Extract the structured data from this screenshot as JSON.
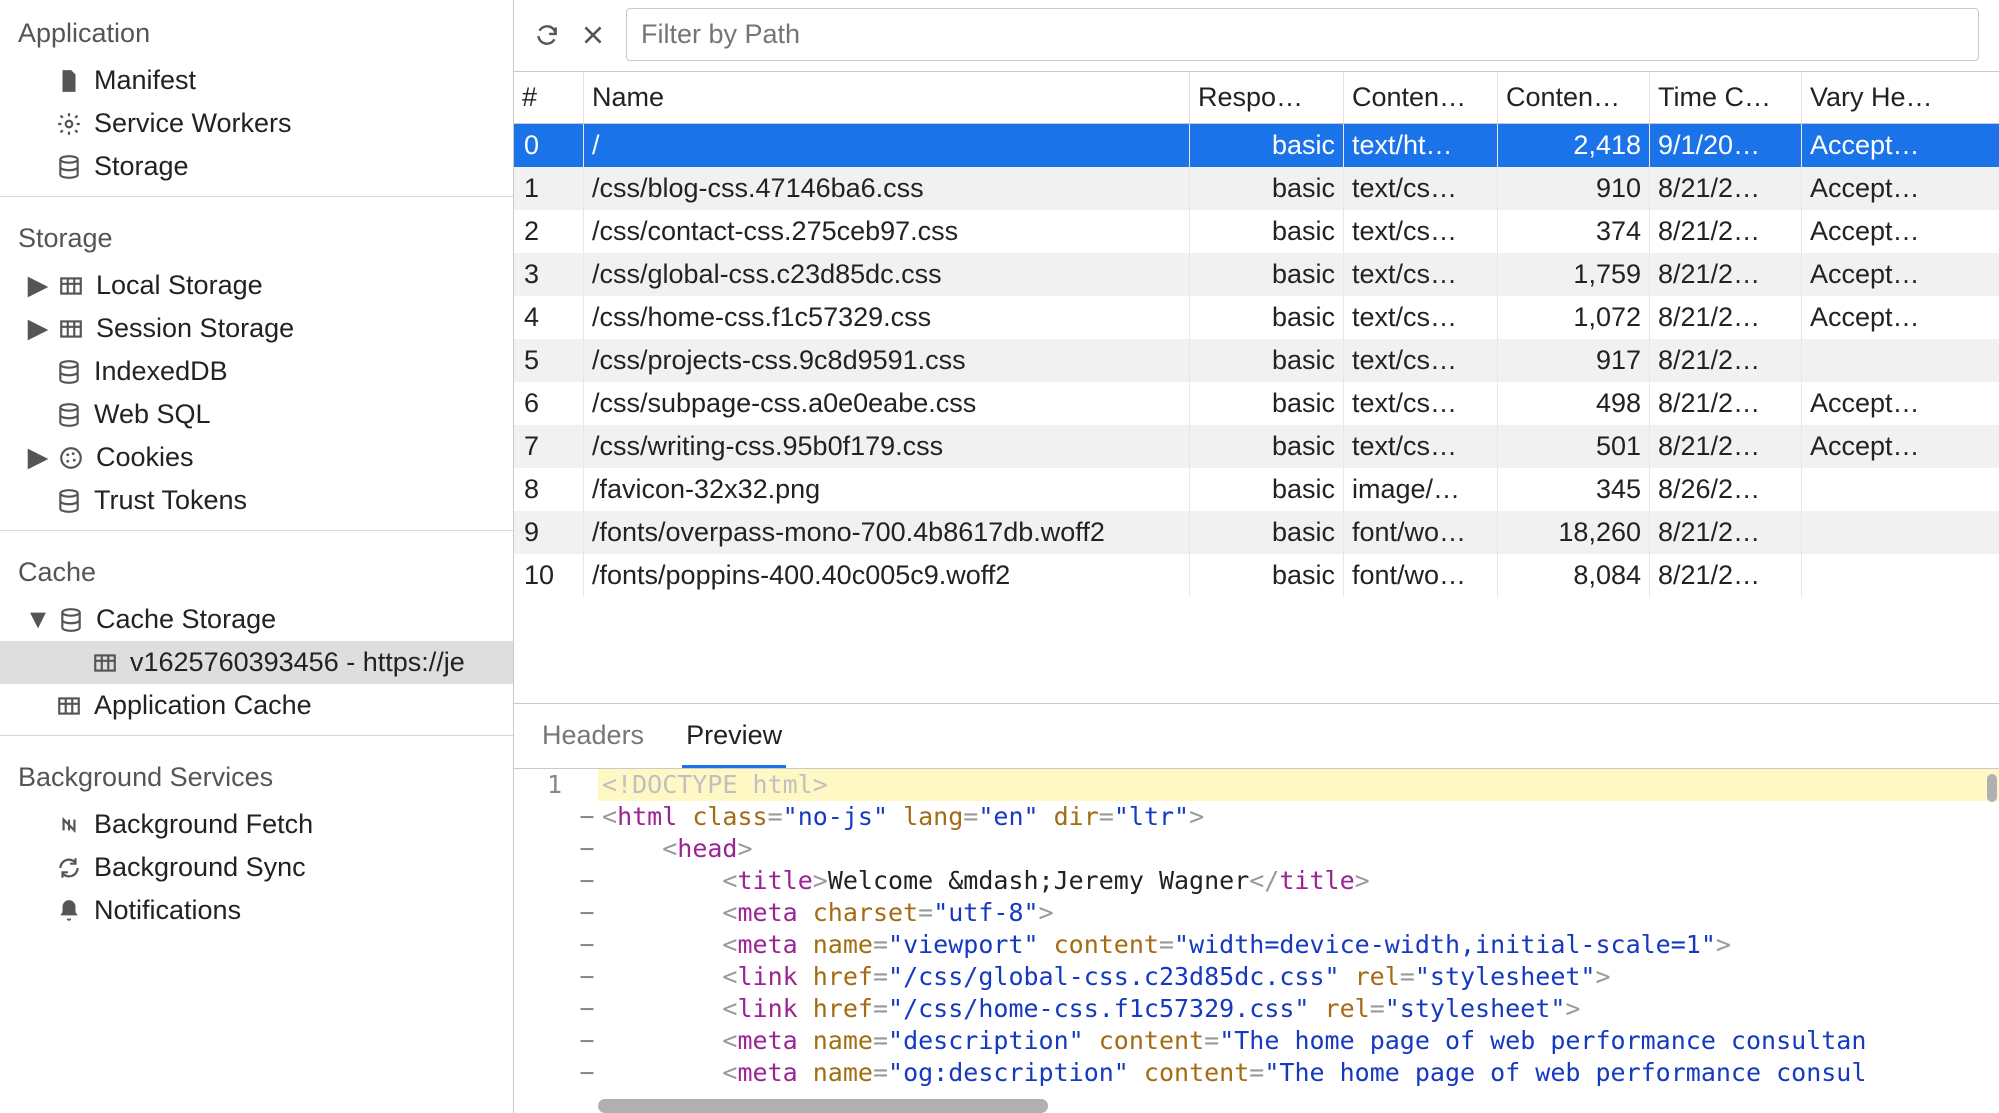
{
  "sidebar": {
    "sections": [
      {
        "title": "Application",
        "items": [
          {
            "id": "manifest",
            "label": "Manifest",
            "icon": "file"
          },
          {
            "id": "service-workers",
            "label": "Service Workers",
            "icon": "gear"
          },
          {
            "id": "storage",
            "label": "Storage",
            "icon": "db"
          }
        ]
      },
      {
        "title": "Storage",
        "items": [
          {
            "id": "local-storage",
            "label": "Local Storage",
            "icon": "table",
            "disclosure": "right"
          },
          {
            "id": "session-storage",
            "label": "Session Storage",
            "icon": "table",
            "disclosure": "right"
          },
          {
            "id": "indexeddb",
            "label": "IndexedDB",
            "icon": "db"
          },
          {
            "id": "web-sql",
            "label": "Web SQL",
            "icon": "db"
          },
          {
            "id": "cookies",
            "label": "Cookies",
            "icon": "cookie",
            "disclosure": "right"
          },
          {
            "id": "trust-tokens",
            "label": "Trust Tokens",
            "icon": "db"
          }
        ]
      },
      {
        "title": "Cache",
        "items": [
          {
            "id": "cache-storage",
            "label": "Cache Storage",
            "icon": "db",
            "disclosure": "down",
            "children": [
              {
                "id": "cache-entry",
                "label": "v1625760393456 - https://je",
                "icon": "table",
                "selected": true
              }
            ]
          },
          {
            "id": "application-cache",
            "label": "Application Cache",
            "icon": "table"
          }
        ]
      },
      {
        "title": "Background Services",
        "items": [
          {
            "id": "background-fetch",
            "label": "Background Fetch",
            "icon": "fetch"
          },
          {
            "id": "background-sync",
            "label": "Background Sync",
            "icon": "sync"
          },
          {
            "id": "notifications",
            "label": "Notifications",
            "icon": "bell"
          }
        ]
      }
    ]
  },
  "toolbar": {
    "refresh_title": "Refresh",
    "delete_title": "Delete Selected",
    "filter_placeholder": "Filter by Path"
  },
  "table": {
    "columns": [
      "#",
      "Name",
      "Respo…",
      "Conten…",
      "Conten…",
      "Time C…",
      "Vary He…"
    ],
    "rows": [
      {
        "idx": "0",
        "name": "/",
        "response": "basic",
        "content_type": "text/ht…",
        "content_length": "2,418",
        "time": "9/1/20…",
        "vary": "Accept…",
        "selected": true
      },
      {
        "idx": "1",
        "name": "/css/blog-css.47146ba6.css",
        "response": "basic",
        "content_type": "text/cs…",
        "content_length": "910",
        "time": "8/21/2…",
        "vary": "Accept…"
      },
      {
        "idx": "2",
        "name": "/css/contact-css.275ceb97.css",
        "response": "basic",
        "content_type": "text/cs…",
        "content_length": "374",
        "time": "8/21/2…",
        "vary": "Accept…"
      },
      {
        "idx": "3",
        "name": "/css/global-css.c23d85dc.css",
        "response": "basic",
        "content_type": "text/cs…",
        "content_length": "1,759",
        "time": "8/21/2…",
        "vary": "Accept…"
      },
      {
        "idx": "4",
        "name": "/css/home-css.f1c57329.css",
        "response": "basic",
        "content_type": "text/cs…",
        "content_length": "1,072",
        "time": "8/21/2…",
        "vary": "Accept…"
      },
      {
        "idx": "5",
        "name": "/css/projects-css.9c8d9591.css",
        "response": "basic",
        "content_type": "text/cs…",
        "content_length": "917",
        "time": "8/21/2…",
        "vary": ""
      },
      {
        "idx": "6",
        "name": "/css/subpage-css.a0e0eabe.css",
        "response": "basic",
        "content_type": "text/cs…",
        "content_length": "498",
        "time": "8/21/2…",
        "vary": "Accept…"
      },
      {
        "idx": "7",
        "name": "/css/writing-css.95b0f179.css",
        "response": "basic",
        "content_type": "text/cs…",
        "content_length": "501",
        "time": "8/21/2…",
        "vary": "Accept…"
      },
      {
        "idx": "8",
        "name": "/favicon-32x32.png",
        "response": "basic",
        "content_type": "image/…",
        "content_length": "345",
        "time": "8/26/2…",
        "vary": ""
      },
      {
        "idx": "9",
        "name": "/fonts/overpass-mono-700.4b8617db.woff2",
        "response": "basic",
        "content_type": "font/wo…",
        "content_length": "18,260",
        "time": "8/21/2…",
        "vary": ""
      },
      {
        "idx": "10",
        "name": "/fonts/poppins-400.40c005c9.woff2",
        "response": "basic",
        "content_type": "font/wo…",
        "content_length": "8,084",
        "time": "8/21/2…",
        "vary": ""
      }
    ]
  },
  "detail": {
    "tabs": [
      {
        "id": "headers",
        "label": "Headers"
      },
      {
        "id": "preview",
        "label": "Preview",
        "active": true
      }
    ]
  },
  "preview_code": {
    "lines": [
      {
        "n": "1",
        "fold": "",
        "hl": true,
        "tokens": [
          {
            "t": "<!DOCTYPE html>",
            "c": "c-doctype"
          }
        ]
      },
      {
        "n": "",
        "fold": "−",
        "indent": 0,
        "tokens": [
          {
            "t": "<",
            "c": "c-punc"
          },
          {
            "t": "html",
            "c": "c-tag"
          },
          {
            "t": " class",
            "c": "c-attr"
          },
          {
            "t": "=",
            "c": "c-punc"
          },
          {
            "t": "\"no-js\"",
            "c": "c-str"
          },
          {
            "t": " lang",
            "c": "c-attr"
          },
          {
            "t": "=",
            "c": "c-punc"
          },
          {
            "t": "\"en\"",
            "c": "c-str"
          },
          {
            "t": " dir",
            "c": "c-attr"
          },
          {
            "t": "=",
            "c": "c-punc"
          },
          {
            "t": "\"ltr\"",
            "c": "c-str"
          },
          {
            "t": ">",
            "c": "c-punc"
          }
        ]
      },
      {
        "n": "",
        "fold": "−",
        "indent": 1,
        "tokens": [
          {
            "t": "<",
            "c": "c-punc"
          },
          {
            "t": "head",
            "c": "c-tag"
          },
          {
            "t": ">",
            "c": "c-punc"
          }
        ]
      },
      {
        "n": "",
        "fold": "−",
        "indent": 2,
        "tokens": [
          {
            "t": "<",
            "c": "c-punc"
          },
          {
            "t": "title",
            "c": "c-tag"
          },
          {
            "t": ">",
            "c": "c-punc"
          },
          {
            "t": "Welcome &mdash;Jeremy Wagner",
            "c": "c-text"
          },
          {
            "t": "</",
            "c": "c-punc"
          },
          {
            "t": "title",
            "c": "c-tag"
          },
          {
            "t": ">",
            "c": "c-punc"
          }
        ]
      },
      {
        "n": "",
        "fold": "−",
        "indent": 2,
        "tokens": [
          {
            "t": "<",
            "c": "c-punc"
          },
          {
            "t": "meta",
            "c": "c-tag"
          },
          {
            "t": " charset",
            "c": "c-attr"
          },
          {
            "t": "=",
            "c": "c-punc"
          },
          {
            "t": "\"utf-8\"",
            "c": "c-str"
          },
          {
            "t": ">",
            "c": "c-punc"
          }
        ]
      },
      {
        "n": "",
        "fold": "−",
        "indent": 2,
        "tokens": [
          {
            "t": "<",
            "c": "c-punc"
          },
          {
            "t": "meta",
            "c": "c-tag"
          },
          {
            "t": " name",
            "c": "c-attr"
          },
          {
            "t": "=",
            "c": "c-punc"
          },
          {
            "t": "\"viewport\"",
            "c": "c-str"
          },
          {
            "t": " content",
            "c": "c-attr"
          },
          {
            "t": "=",
            "c": "c-punc"
          },
          {
            "t": "\"width=device-width,initial-scale=1\"",
            "c": "c-str"
          },
          {
            "t": ">",
            "c": "c-punc"
          }
        ]
      },
      {
        "n": "",
        "fold": "−",
        "indent": 2,
        "tokens": [
          {
            "t": "<",
            "c": "c-punc"
          },
          {
            "t": "link",
            "c": "c-tag"
          },
          {
            "t": " href",
            "c": "c-attr"
          },
          {
            "t": "=",
            "c": "c-punc"
          },
          {
            "t": "\"/css/global-css.c23d85dc.css\"",
            "c": "c-str"
          },
          {
            "t": " rel",
            "c": "c-attr"
          },
          {
            "t": "=",
            "c": "c-punc"
          },
          {
            "t": "\"stylesheet\"",
            "c": "c-str"
          },
          {
            "t": ">",
            "c": "c-punc"
          }
        ]
      },
      {
        "n": "",
        "fold": "−",
        "indent": 2,
        "tokens": [
          {
            "t": "<",
            "c": "c-punc"
          },
          {
            "t": "link",
            "c": "c-tag"
          },
          {
            "t": " href",
            "c": "c-attr"
          },
          {
            "t": "=",
            "c": "c-punc"
          },
          {
            "t": "\"/css/home-css.f1c57329.css\"",
            "c": "c-str"
          },
          {
            "t": " rel",
            "c": "c-attr"
          },
          {
            "t": "=",
            "c": "c-punc"
          },
          {
            "t": "\"stylesheet\"",
            "c": "c-str"
          },
          {
            "t": ">",
            "c": "c-punc"
          }
        ]
      },
      {
        "n": "",
        "fold": "−",
        "indent": 2,
        "tokens": [
          {
            "t": "<",
            "c": "c-punc"
          },
          {
            "t": "meta",
            "c": "c-tag"
          },
          {
            "t": " name",
            "c": "c-attr"
          },
          {
            "t": "=",
            "c": "c-punc"
          },
          {
            "t": "\"description\"",
            "c": "c-str"
          },
          {
            "t": " content",
            "c": "c-attr"
          },
          {
            "t": "=",
            "c": "c-punc"
          },
          {
            "t": "\"The home page of web performance consultan",
            "c": "c-str"
          }
        ]
      },
      {
        "n": "",
        "fold": "−",
        "indent": 2,
        "tokens": [
          {
            "t": "<",
            "c": "c-punc"
          },
          {
            "t": "meta",
            "c": "c-tag"
          },
          {
            "t": " name",
            "c": "c-attr"
          },
          {
            "t": "=",
            "c": "c-punc"
          },
          {
            "t": "\"og:description\"",
            "c": "c-str"
          },
          {
            "t": " content",
            "c": "c-attr"
          },
          {
            "t": "=",
            "c": "c-punc"
          },
          {
            "t": "\"The home page of web performance consul",
            "c": "c-str"
          }
        ]
      }
    ]
  }
}
